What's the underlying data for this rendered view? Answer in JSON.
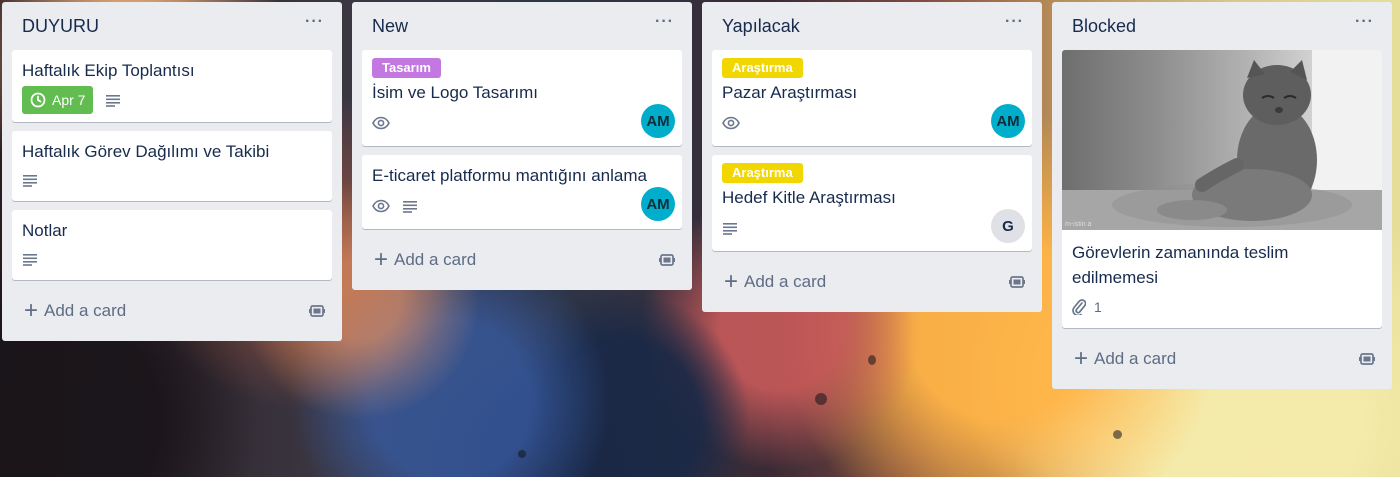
{
  "lists": [
    {
      "title": "DUYURU",
      "cards": [
        {
          "title": "Haftalık Ekip Toplantısı",
          "due": "Apr 7"
        },
        {
          "title": "Haftalık Görev Dağılımı ve Takibi"
        },
        {
          "title": "Notlar"
        }
      ],
      "add_card_label": "Add a card"
    },
    {
      "title": "New",
      "cards": [
        {
          "label": "Tasarım",
          "label_color": "#c377e0",
          "title": "İsim ve Logo Tasarımı",
          "member": "AM"
        },
        {
          "title": "E-ticaret platformu mantığını anlama",
          "member": "AM"
        }
      ],
      "add_card_label": "Add a card"
    },
    {
      "title": "Yapılacak",
      "cards": [
        {
          "label": "Araştırma",
          "label_color": "#f2d600",
          "title": "Pazar Araştırması",
          "member": "AM"
        },
        {
          "label": "Araştırma",
          "label_color": "#f2d600",
          "title": "Hedef Kitle Araştırması",
          "member": "G"
        }
      ],
      "add_card_label": "Add a card"
    },
    {
      "title": "Blocked",
      "cards": [
        {
          "cover_watermark": "m-istin a",
          "title": "Görevlerin zamanında teslim edilmemesi",
          "attachments": "1"
        }
      ],
      "add_card_label": "Add a card"
    }
  ],
  "menu_glyph": "···",
  "colors": {
    "list_bg": "#ebecf0",
    "due_green": "#61bd4f",
    "avatar_teal": "#00aecc"
  }
}
